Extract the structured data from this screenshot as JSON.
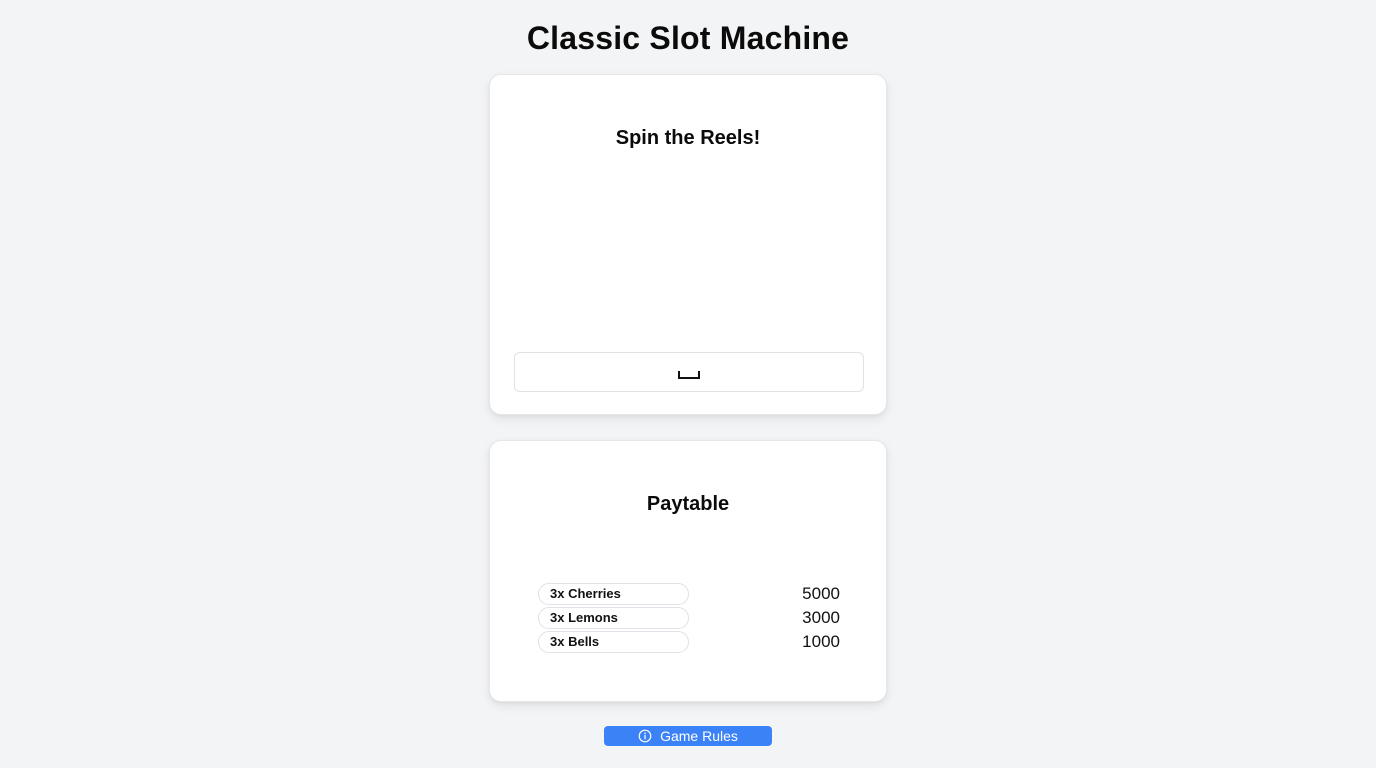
{
  "page": {
    "title": "Classic Slot Machine"
  },
  "slot_card": {
    "heading": "Spin the Reels!",
    "spin_input_value": "",
    "spin_input_icon": "space-key-icon"
  },
  "paytable_card": {
    "heading": "Paytable",
    "rows": [
      {
        "label": "3x Cherries",
        "value": "5000"
      },
      {
        "label": "3x Lemons",
        "value": "3000"
      },
      {
        "label": "3x Bells",
        "value": "1000"
      }
    ]
  },
  "footer": {
    "rules_button_label": "Game Rules",
    "rules_button_icon": "info-icon"
  },
  "colors": {
    "background": "#f3f4f6",
    "card": "#ffffff",
    "accent": "#3b82f6"
  }
}
